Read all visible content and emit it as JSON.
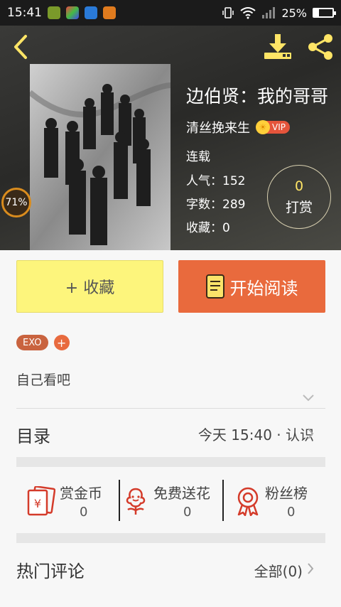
{
  "status_bar": {
    "time": "15:41",
    "battery_percent": "25%",
    "battery_level": 0.25,
    "app_icons": [
      "cat-app-icon",
      "gift-app-icon",
      "screenshot-app-icon",
      "camera-app-icon"
    ],
    "system_icons": [
      "vibrate-icon",
      "wifi-icon",
      "signal-icon",
      "battery-icon"
    ]
  },
  "header": {
    "book_title": "边伯贤：我的哥哥",
    "author": "清丝挽来生",
    "vip_label": "VIP",
    "status": "连载",
    "popularity": "人气：152",
    "word_count": "字数：289",
    "favorites": "收藏：0",
    "read_progress": "71%",
    "reward": {
      "count": "0",
      "label": "打赏"
    }
  },
  "actions": {
    "collect_label": "+ 收藏",
    "read_label": "开始阅读"
  },
  "tags": {
    "items": [
      "EXO"
    ],
    "add_label": "+"
  },
  "summary": "自己看吧",
  "toc": {
    "label": "目录",
    "update": "今天 15:40 · 认识"
  },
  "stats": [
    {
      "label": "赏金币",
      "value": "0",
      "icon": "red-envelope-icon"
    },
    {
      "label": "免费送花",
      "value": "0",
      "icon": "flower-icon"
    },
    {
      "label": "粉丝榜",
      "value": "0",
      "icon": "medal-icon"
    }
  ],
  "comments": {
    "label": "热门评论",
    "all_label": "全部(0)"
  },
  "colors": {
    "accent_orange": "#e96a3d",
    "collect_yellow": "#fdf57c",
    "icon_yellow": "#ffe566",
    "tag_red": "#c9633f"
  }
}
